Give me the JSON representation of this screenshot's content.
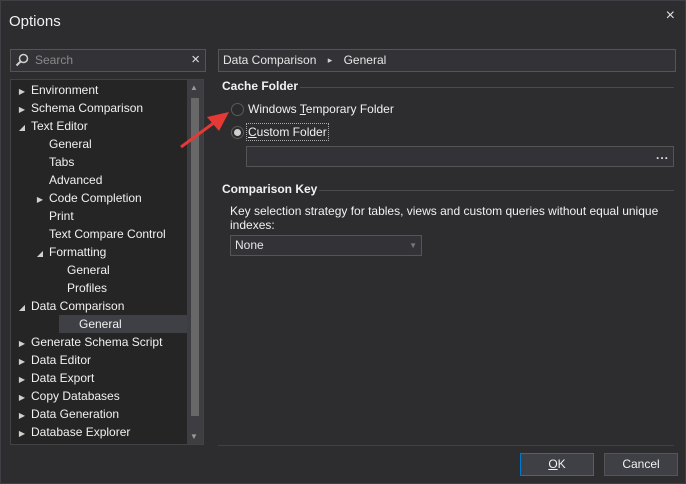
{
  "window": {
    "title": "Options",
    "close_glyph": "×"
  },
  "search": {
    "placeholder": "Search",
    "clear_glyph": "×"
  },
  "tree": [
    {
      "label": "Environment",
      "expander": "right",
      "level": 0
    },
    {
      "label": "Schema Comparison",
      "expander": "right",
      "level": 0
    },
    {
      "label": "Text Editor",
      "expander": "down",
      "level": 0
    },
    {
      "label": "General",
      "expander": "",
      "level": 1
    },
    {
      "label": "Tabs",
      "expander": "",
      "level": 1
    },
    {
      "label": "Advanced",
      "expander": "",
      "level": 1
    },
    {
      "label": "Code Completion",
      "expander": "right",
      "level": 1
    },
    {
      "label": "Print",
      "expander": "",
      "level": 1
    },
    {
      "label": "Text Compare Control",
      "expander": "",
      "level": 1
    },
    {
      "label": "Formatting",
      "expander": "down",
      "level": 1
    },
    {
      "label": "General",
      "expander": "",
      "level": 2
    },
    {
      "label": "Profiles",
      "expander": "",
      "level": 2
    },
    {
      "label": "Data Comparison",
      "expander": "down",
      "level": 0
    },
    {
      "label": "General",
      "expander": "",
      "level": 1,
      "selected": true
    },
    {
      "label": "Generate Schema Script",
      "expander": "right",
      "level": 0
    },
    {
      "label": "Data Editor",
      "expander": "right",
      "level": 0
    },
    {
      "label": "Data Export",
      "expander": "right",
      "level": 0
    },
    {
      "label": "Copy Databases",
      "expander": "right",
      "level": 0
    },
    {
      "label": "Data Generation",
      "expander": "right",
      "level": 0
    },
    {
      "label": "Database Explorer",
      "expander": "right",
      "level": 0
    }
  ],
  "breadcrumb": {
    "part1": "Data Comparison",
    "sep": "▸",
    "part2": "General"
  },
  "cache_folder": {
    "heading": "Cache Folder",
    "option1_pre": "Windows ",
    "option1_u": "T",
    "option1_post": "emporary Folder",
    "option2_u": "C",
    "option2_post": "ustom Folder",
    "path_value": "",
    "browse_glyph": "..."
  },
  "comparison_key": {
    "heading": "Comparison Key",
    "description": "Key selection strategy for tables, views and custom queries without equal unique indexes:",
    "selected": "None"
  },
  "buttons": {
    "ok_u": "O",
    "ok_rest": "K",
    "cancel": "Cancel"
  },
  "colors": {
    "accent": "#007acc",
    "annotation_arrow": "#e53935"
  }
}
